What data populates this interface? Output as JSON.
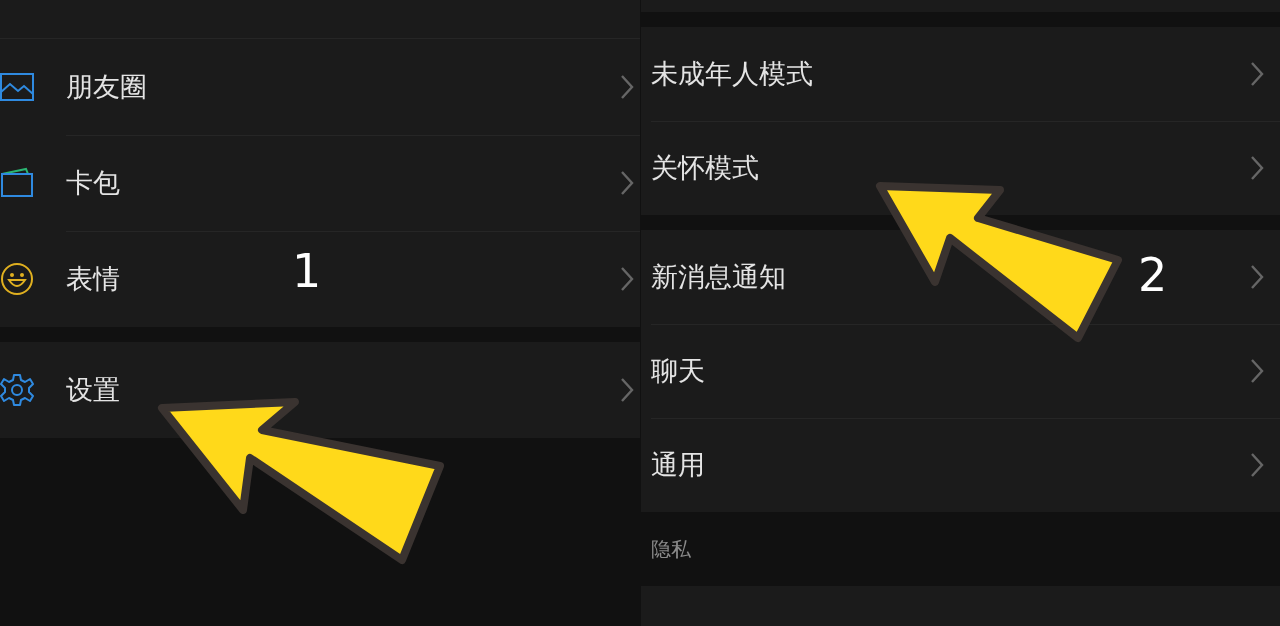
{
  "left_panel": {
    "sections": [
      {
        "items": [
          {
            "label": "朋友圈",
            "kind": "moments"
          },
          {
            "label": "卡包",
            "kind": "wallet"
          },
          {
            "label": "表情",
            "kind": "emoji"
          }
        ]
      },
      {
        "items": [
          {
            "label": "设置",
            "kind": "settings"
          }
        ]
      }
    ]
  },
  "right_panel": {
    "sections": [
      {
        "items": [
          {
            "label": "未成年人模式"
          },
          {
            "label": "关怀模式"
          }
        ]
      },
      {
        "items": [
          {
            "label": "新消息通知"
          },
          {
            "label": "聊天"
          },
          {
            "label": "通用"
          }
        ]
      },
      {
        "header": "隐私"
      }
    ]
  },
  "annotations": [
    {
      "label": "1"
    },
    {
      "label": "2"
    }
  ]
}
